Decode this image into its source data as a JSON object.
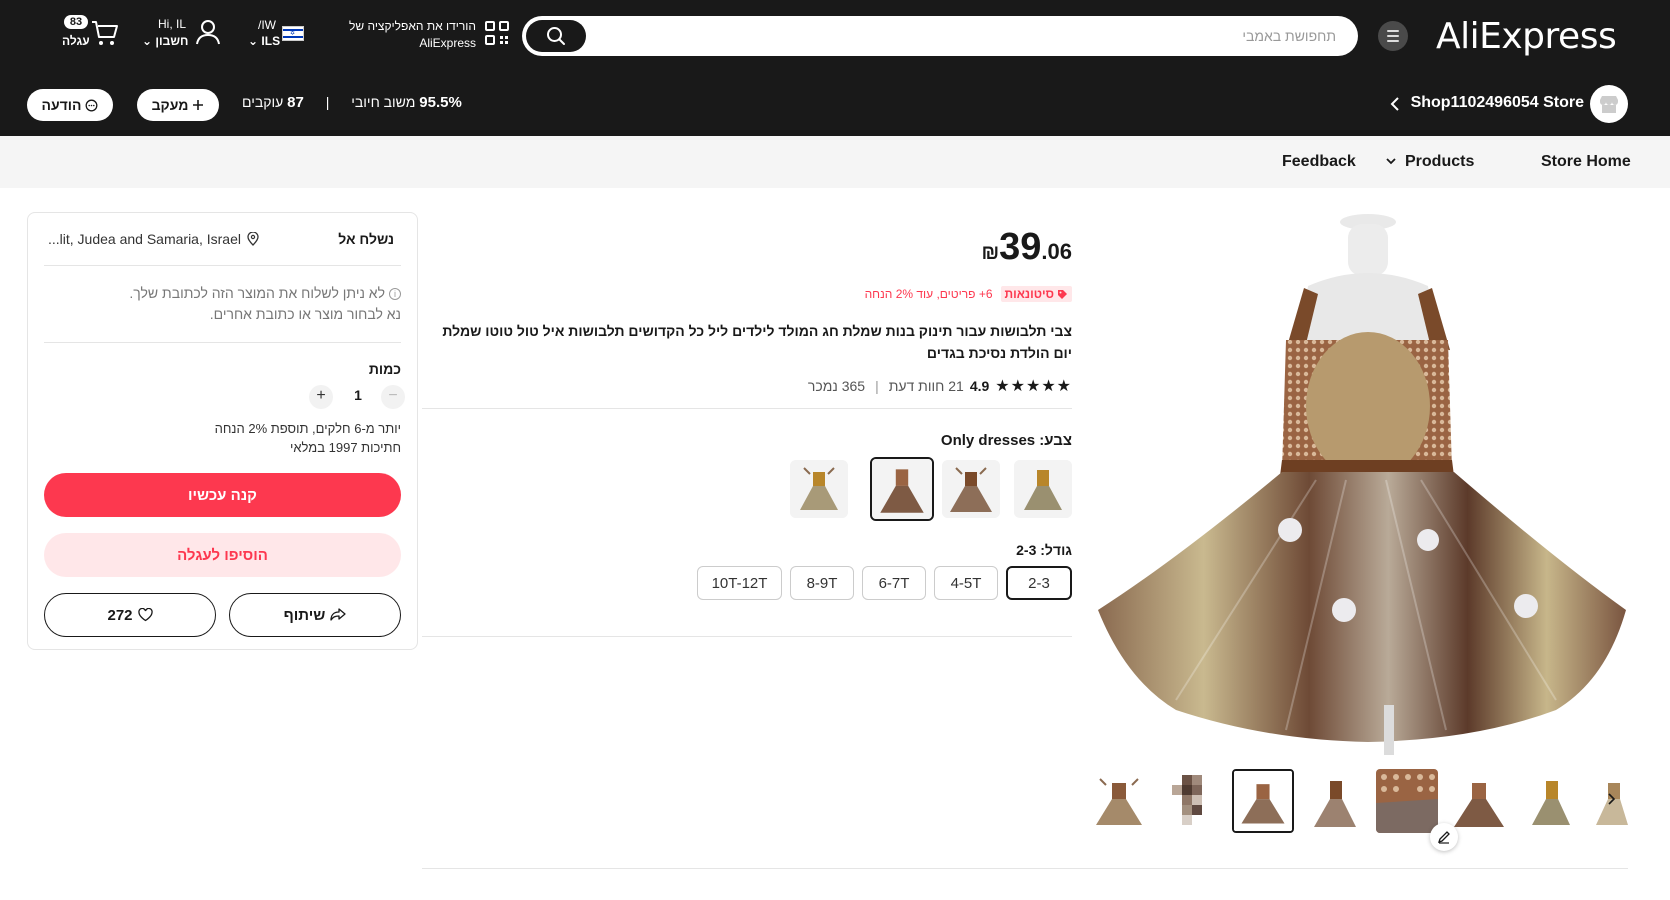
{
  "header": {
    "logo": "AliExpress",
    "search_placeholder": "תחפושת באמבי",
    "app_download_line1": "הורידו את האפליקציה של",
    "app_download_line2": "AliExpress",
    "locale_line1": "/IW",
    "locale_line2": "ILS",
    "account_line1": "Hi, IL",
    "account_line2": "חשבון",
    "cart_count": "83",
    "cart_label": "עגלה"
  },
  "store": {
    "name": "Shop1102496054 Store",
    "positive_value": "95.5%",
    "positive_label": "משוב חיובי",
    "followers_value": "87",
    "followers_label": "עוקבים",
    "follow_label": "מעקב",
    "message_label": "הודעה"
  },
  "nav": {
    "store_home": "Store Home",
    "products": "Products",
    "feedback": "Feedback"
  },
  "product": {
    "price_currency": "₪",
    "price_int": "39",
    "price_dec": ".06",
    "promo_tag": "סיטונאות",
    "promo_text": "6+ פריטים, עוד 2% הנחה",
    "title": "צבי תלבושות עבור תינוק בנות שמלת חג המולד לילדים ליל כל הקדושים תלבושות איל טול טוטו שמלת יום הולדת נסיכת בגדים",
    "rating_stars": "★★★★★",
    "rating_score": "4.9",
    "reviews": "21 חוות דעת",
    "sold": "365 נמכר",
    "color_label": "צבע: Only dresses",
    "size_label": "גודל: 2-3",
    "sizes": [
      "2-3",
      "4-5T",
      "6-7T",
      "8-9T",
      "10T-12T"
    ]
  },
  "panel": {
    "ship_to_label": "נשלח אל",
    "ship_to_address": "...lit, Judea and Samaria, Israel",
    "ship_warning_line1": "לא ניתן לשלוח את המוצר הזה לכתובת שלך.",
    "ship_warning_line2": "נא לבחור מוצר או כתובת אחרים.",
    "quantity_label": "כמות",
    "quantity_value": "1",
    "bulk_line1": "יותר מ-6 חלקים, תוספת 2% הנחה",
    "bulk_line2": "חתיכות 1997 במלאי",
    "buy_now": "קנה עכשיו",
    "add_to_cart": "הוסיפו לעגלה",
    "share": "שיתוף",
    "wishlist_count": "272"
  },
  "colors": {
    "brand_red": "#fd384f",
    "brand_red_light": "#ffe7e9",
    "header_bg": "#191919"
  }
}
